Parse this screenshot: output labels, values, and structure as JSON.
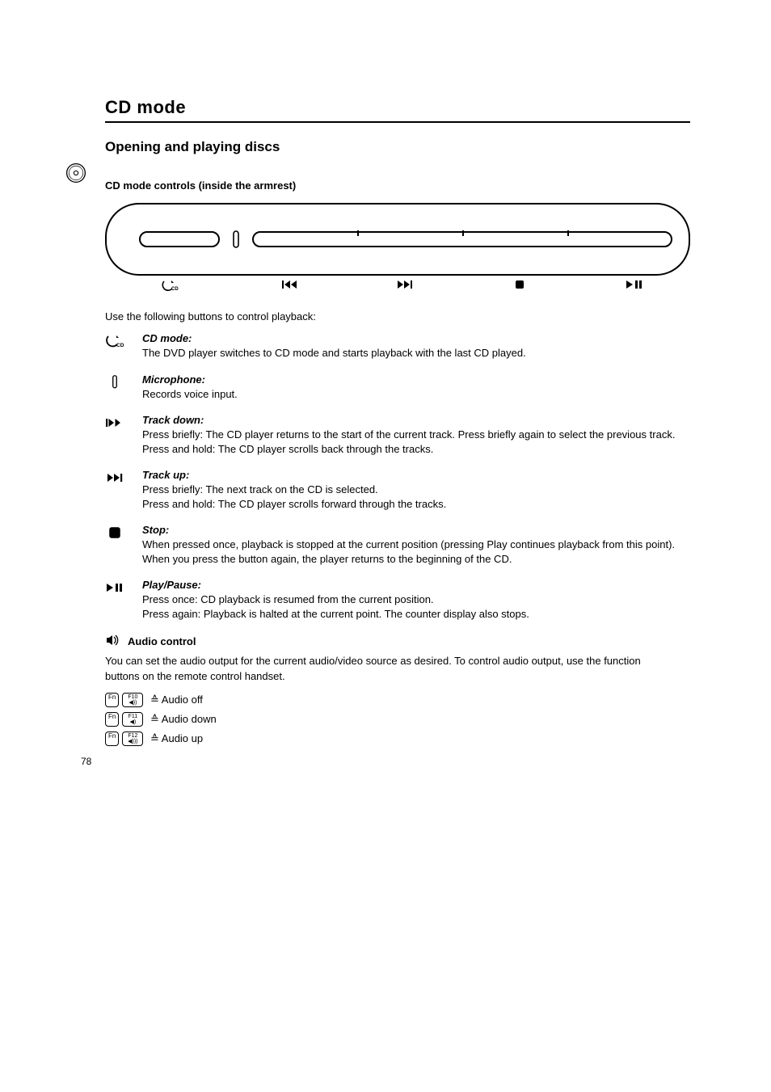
{
  "page": {
    "number": "78"
  },
  "disc_icon": "disc-icon",
  "header": {
    "title": "CD mode",
    "subtitle": "Opening and playing discs"
  },
  "controls_heading": "CD mode controls (inside the armrest)",
  "description_intro": "Use the following buttons to control playback:",
  "panel": {
    "buttons": [
      "cd-mode",
      "prev",
      "next",
      "stop",
      "play-pause"
    ]
  },
  "functions": [
    {
      "icon": "cd-mode",
      "name": "CD mode:",
      "desc": "The DVD player switches to CD mode and starts playback with the last CD played."
    },
    {
      "icon": "mic",
      "name": "Microphone:",
      "desc": "Records voice input."
    },
    {
      "icon": "prev",
      "name": "Track down:",
      "desc": "Press briefly: The CD player returns to the start of the current track. Press briefly again to select the previous track.\nPress and hold: The CD player scrolls back through the tracks."
    },
    {
      "icon": "next",
      "name": "Track up:",
      "desc": "Press briefly: The next track on the CD is selected.\nPress and hold: The CD player scrolls forward through the tracks."
    },
    {
      "icon": "stop",
      "name": "Stop:",
      "desc": "When pressed once, playback is stopped at the current position (pressing Play continues playback from this point). When you press the button again, the player returns to the beginning of the CD."
    },
    {
      "icon": "play",
      "name": "Play/Pause:",
      "desc": "Press once: CD playback is resumed from the current position.\nPress again: Playback is halted at the current point. The counter display also stops."
    }
  ],
  "audio": {
    "heading": "Audio control",
    "note": "You can set the audio output for the current audio/video source as desired. To control audio output, use the function buttons on the remote control handset.",
    "lines": [
      {
        "keys": [
          "Fn",
          "F10"
        ],
        "keylabels": [
          "Fn",
          "F10\n◀))"
        ],
        "text": "≙ Audio off"
      },
      {
        "keys": [
          "Fn",
          "F11"
        ],
        "keylabels": [
          "Fn",
          "F11\n◀)"
        ],
        "text": "≙ Audio down"
      },
      {
        "keys": [
          "Fn",
          "F12"
        ],
        "keylabels": [
          "Fn",
          "F12\n◀)))"
        ],
        "text": "≙ Audio up"
      }
    ]
  }
}
